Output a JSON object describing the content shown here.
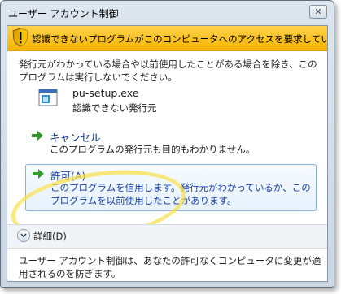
{
  "window": {
    "title": "ユーザー アカウント制御",
    "close_glyph": "✕"
  },
  "banner": {
    "icon": "shield-warning-icon",
    "text": "認識できないプログラムがこのコンピュータへのアクセスを要求しています",
    "color": "#f5b400"
  },
  "intro": "発行元がわかっている場合や以前使用したことがある場合を除き、このプログラムは実行しないでください。",
  "program": {
    "icon": "program-icon",
    "name": "pu-setup.exe",
    "publisher": "認識できない発行元"
  },
  "commands": {
    "cancel": {
      "icon": "green-arrow-icon",
      "title": "キャンセル",
      "description": "このプログラムの発行元も目的もわかりません。"
    },
    "allow": {
      "icon": "green-arrow-icon",
      "title": "許可(A)",
      "description": "このプログラムを信用します。発行元がわかっているか、このプログラムを以前使用したことがあります。"
    }
  },
  "details": {
    "icon": "chevron-down-icon",
    "label": "詳細(D)"
  },
  "footer": "ユーザー アカウント制御は、あなたの許可なくコンピュータに変更が適用されるのを防ぎます。"
}
